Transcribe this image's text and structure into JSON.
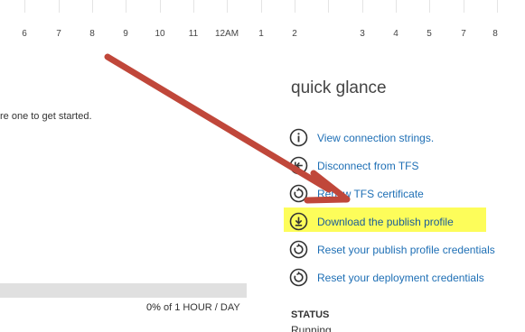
{
  "timeline": {
    "ticks": [
      "6",
      "7",
      "8",
      "9",
      "10",
      "11",
      "12AM",
      "1",
      "2",
      "3",
      "4",
      "5",
      "7",
      "8"
    ]
  },
  "main": {
    "empty_message": "re one to get started.",
    "usage": {
      "percent_label": "0%",
      "of_text": " of 1 HOUR / DAY",
      "fraction": 0
    }
  },
  "quick_glance": {
    "title": "quick glance",
    "links": [
      {
        "label": "View connection strings.",
        "icon": "info-icon"
      },
      {
        "label": "Disconnect from TFS",
        "icon": "disconnect-icon"
      },
      {
        "label": "Renew TFS certificate",
        "icon": "refresh-icon"
      },
      {
        "label": "Download the publish profile",
        "icon": "download-icon"
      },
      {
        "label": "Reset your publish profile credentials",
        "icon": "reset-icon"
      },
      {
        "label": "Reset your deployment credentials",
        "icon": "reset-icon"
      }
    ],
    "highlighted_link": "Download the publish profile",
    "status_label": "STATUS",
    "status_value": "Running"
  },
  "colors": {
    "link": "#1e6fb5",
    "highlight": "#fdfd5a",
    "arrow": "#c0473a",
    "icon_stroke": "#333333"
  }
}
